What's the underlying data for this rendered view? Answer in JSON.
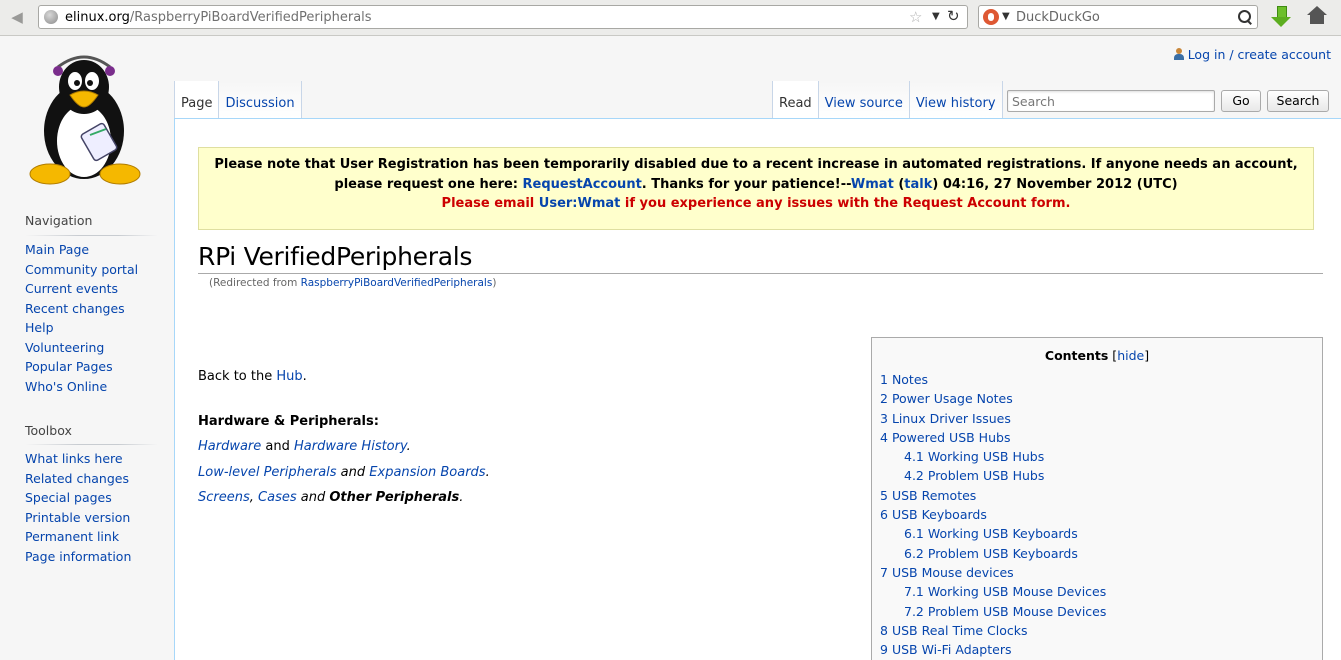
{
  "browser": {
    "url_domain": "elinux.org",
    "url_path": "/RaspberryPiBoardVerifiedPeripherals",
    "search_engine": "DuckDuckGo"
  },
  "personal": {
    "login": "Log in / create account"
  },
  "tabs": {
    "page": "Page",
    "discussion": "Discussion",
    "read": "Read",
    "view_source": "View source",
    "view_history": "View history"
  },
  "search": {
    "placeholder": "Search",
    "go": "Go",
    "search": "Search"
  },
  "sidebar": {
    "navigation_heading": "Navigation",
    "navigation": [
      "Main Page",
      "Community portal",
      "Current events",
      "Recent changes",
      "Help",
      "Volunteering",
      "Popular Pages",
      "Who's Online"
    ],
    "toolbox_heading": "Toolbox",
    "toolbox": [
      "What links here",
      "Related changes",
      "Special pages",
      "Printable version",
      "Permanent link",
      "Page information"
    ]
  },
  "notice": {
    "line1": "Please note that User Registration has been temporarily disabled due to a recent increase in automated registrations. If anyone needs an account,",
    "line2_a": "please request one here: ",
    "line2_link1": "RequestAccount",
    "line2_b": ". Thanks for your patience!--",
    "line2_link2": "Wmat",
    "line2_c": " (",
    "line2_link3": "talk",
    "line2_d": ") 04:16, 27 November 2012 (UTC)",
    "line3_a": "Please email ",
    "line3_link": "User:Wmat",
    "line3_b": " if you experience any issues with the Request Account form."
  },
  "title": "RPi VerifiedPeripherals",
  "redirect": {
    "prefix": "(Redirected from ",
    "link": "RaspberryPiBoardVerifiedPeripherals",
    "suffix": ")"
  },
  "body": {
    "back_prefix": "Back to the ",
    "back_link": "Hub",
    "back_suffix": ".",
    "section_heading": "Hardware & Peripherals:",
    "hardware": "Hardware",
    "and1": " and ",
    "hardware_history": "Hardware History",
    "period1": ".",
    "low_level": "Low-level Peripherals",
    "and2": " and ",
    "expansion": "Expansion Boards",
    "period2": ".",
    "screens": "Screens",
    "comma": ", ",
    "cases": "Cases",
    "and3": " and ",
    "other": "Other Peripherals",
    "period3": "."
  },
  "toc": {
    "title": "Contents",
    "hide": "hide",
    "items": [
      {
        "num": "1",
        "label": "Notes"
      },
      {
        "num": "2",
        "label": "Power Usage Notes"
      },
      {
        "num": "3",
        "label": "Linux Driver Issues"
      },
      {
        "num": "4",
        "label": "Powered USB Hubs"
      },
      {
        "num": "4.1",
        "label": "Working USB Hubs"
      },
      {
        "num": "4.2",
        "label": "Problem USB Hubs"
      },
      {
        "num": "5",
        "label": "USB Remotes"
      },
      {
        "num": "6",
        "label": "USB Keyboards"
      },
      {
        "num": "6.1",
        "label": "Working USB Keyboards"
      },
      {
        "num": "6.2",
        "label": "Problem USB Keyboards"
      },
      {
        "num": "7",
        "label": "USB Mouse devices"
      },
      {
        "num": "7.1",
        "label": "Working USB Mouse Devices"
      },
      {
        "num": "7.2",
        "label": "Problem USB Mouse Devices"
      },
      {
        "num": "8",
        "label": "USB Real Time Clocks"
      },
      {
        "num": "9",
        "label": "USB Wi-Fi Adapters"
      }
    ]
  },
  "colors": {
    "link": "#0645ad",
    "notice_bg": "#ffffcc",
    "notice_red": "#cc0000"
  }
}
